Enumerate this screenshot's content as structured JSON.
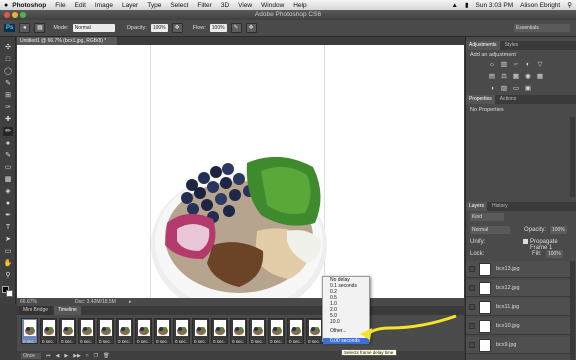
{
  "menubar": {
    "apple": "",
    "items": [
      "Photoshop",
      "File",
      "Edit",
      "Image",
      "Layer",
      "Type",
      "Select",
      "Filter",
      "3D",
      "View",
      "Window",
      "Help"
    ],
    "clock": "Sun 3:03 PM",
    "user": "Alison Ebright"
  },
  "window": {
    "title": "Adobe Photoshop CS6"
  },
  "options": {
    "ps_logo": "Ps",
    "mode_label": "Mode:",
    "mode_value": "Normal",
    "opacity_label": "Opacity:",
    "opacity_value": "100%",
    "flow_label": "Flow:",
    "flow_value": "100%",
    "workspace": "Essentials"
  },
  "document": {
    "tab": "Untitled1 @ 66.7% (bcx1.jpg, RGB/8) *",
    "zoom": "66.67%",
    "doc_size": "Doc: 3.42M/18.5M"
  },
  "panel_tabs": [
    "Mini Bridge",
    "Timeline"
  ],
  "timeline": {
    "frames": [
      {
        "num": "1",
        "delay": "0 sec."
      },
      {
        "num": "2",
        "delay": "0 sec."
      },
      {
        "num": "3",
        "delay": "0 sec."
      },
      {
        "num": "4",
        "delay": "0 sec."
      },
      {
        "num": "5",
        "delay": "0 sec."
      },
      {
        "num": "6",
        "delay": "0 sec."
      },
      {
        "num": "7",
        "delay": "0 sec."
      },
      {
        "num": "8",
        "delay": "0 sec."
      },
      {
        "num": "9",
        "delay": "0 sec."
      },
      {
        "num": "10",
        "delay": "0 sec."
      },
      {
        "num": "11",
        "delay": "0 sec."
      },
      {
        "num": "12",
        "delay": "0 sec."
      },
      {
        "num": "13",
        "delay": "0 sec."
      },
      {
        "num": "14",
        "delay": "0 sec."
      },
      {
        "num": "15",
        "delay": "0 sec."
      },
      {
        "num": "16",
        "delay": "0 sec."
      },
      {
        "num": "17",
        "delay": "0 sec."
      }
    ],
    "loop": "Once"
  },
  "delay_menu": {
    "options": [
      "No delay",
      "0.1 seconds",
      "0.2",
      "0.5",
      "1.0",
      "2.0",
      "5.0",
      "10.0",
      "Other...",
      "0.00 seconds"
    ],
    "selected_index": 9
  },
  "tooltip": "Selects frame delay time",
  "adjustments": {
    "tabs": [
      "Adjustments",
      "Styles"
    ],
    "heading": "Add an adjustment"
  },
  "properties": {
    "tabs": [
      "Properties",
      "Actions"
    ],
    "text": "No Properties"
  },
  "layers": {
    "tabs": [
      "Layers",
      "History"
    ],
    "kind_filter": "Kind",
    "blend_mode": "Normal",
    "opacity_label": "Opacity:",
    "opacity_value": "100%",
    "unify_label": "Unify:",
    "propagate_label": "Propagate Frame 1",
    "lock_label": "Lock:",
    "fill_label": "Fill:",
    "fill_value": "100%",
    "items": [
      "bcx13.jpg",
      "bcx12.jpg",
      "bcx11.jpg",
      "bcx10.jpg",
      "bcx9.jpg"
    ]
  }
}
